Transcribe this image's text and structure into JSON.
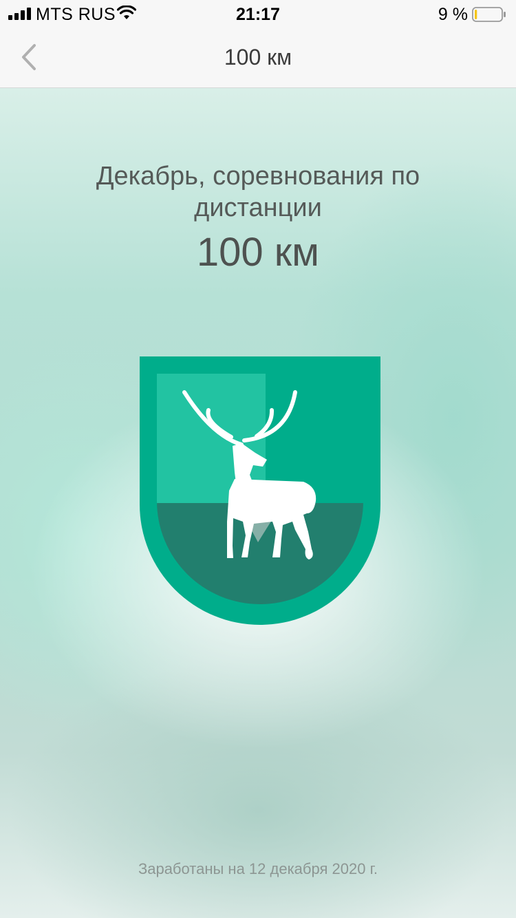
{
  "status_bar": {
    "carrier": "MTS RUS",
    "time": "21:17",
    "battery_percent": "9 %",
    "battery_level": 0.09,
    "icons": [
      "signal-icon",
      "wifi-icon",
      "battery-icon"
    ]
  },
  "nav": {
    "title": "100 км",
    "back_icon": "chevron-left-icon"
  },
  "achievement": {
    "title": "Декабрь, соревнования по дистанции",
    "distance": "100 км",
    "badge_icon": "deer-shield-badge",
    "earned_text": "Заработаны на 12 декабря 2020 г."
  },
  "colors": {
    "badge_outer": "#00ad8b",
    "badge_light": "#22c3a2",
    "badge_dark": "#227f6e",
    "deer": "#ffffff",
    "text": "#555a58"
  }
}
